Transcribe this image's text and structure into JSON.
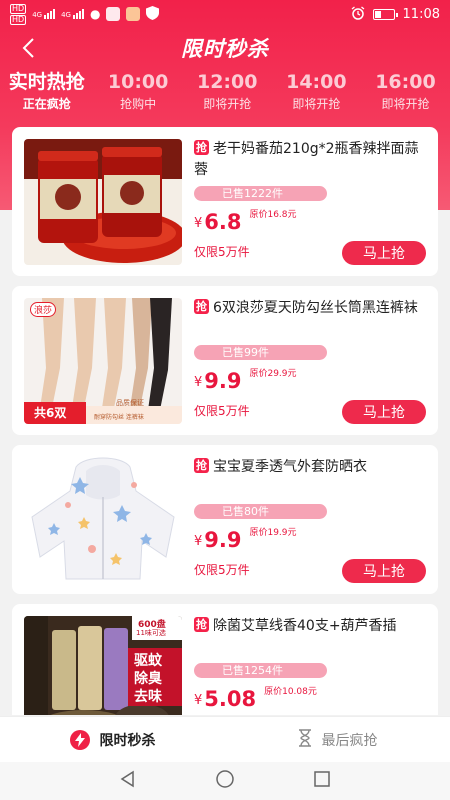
{
  "status_bar": {
    "time": "11:08",
    "left_chips": [
      "HD",
      "HD"
    ],
    "network_labels": [
      "4G",
      "4G"
    ]
  },
  "header": {
    "title": "限时秒杀",
    "back_icon": "back-arrow-icon"
  },
  "timeline": [
    {
      "time": "实时热抢",
      "status": "正在疯抢",
      "active": true
    },
    {
      "time": "10:00",
      "status": "抢购中"
    },
    {
      "time": "12:00",
      "status": "即将开抢"
    },
    {
      "time": "14:00",
      "status": "即将开抢"
    },
    {
      "time": "16:00",
      "status": "即将开抢"
    }
  ],
  "tag_label": "抢",
  "buy_label": "马上抢",
  "products": [
    {
      "name": "老干妈番茄210g*2瓶香辣拌面蒜蓉",
      "sold": "已售1222件",
      "yen": "¥",
      "price": "6.8",
      "original": "原价16.8元",
      "limit": "仅限5万件"
    },
    {
      "name": "6双浪莎夏天防勾丝长筒黑连裤袜",
      "sold": "已售99件",
      "yen": "¥",
      "price": "9.9",
      "original": "原价29.9元",
      "limit": "仅限5万件",
      "image_text": {
        "brand": "浪莎",
        "count": "共6双",
        "badge_top": "品质保证",
        "badge_bottom": "耐穿防勾丝 连裤袜"
      }
    },
    {
      "name": "宝宝夏季透气外套防晒衣",
      "sold": "已售80件",
      "yen": "¥",
      "price": "9.9",
      "original": "原价19.9元",
      "limit": "仅限5万件"
    },
    {
      "name": "除菌艾草线香40支+葫芦香插",
      "sold": "已售1254件",
      "yen": "¥",
      "price": "5.08",
      "original": "原价10.08元",
      "limit": "",
      "image_text": {
        "corner_top": "600盘",
        "corner_bottom": "11味可选",
        "slogan": [
          "驱蚊",
          "除臭",
          "去味"
        ]
      }
    }
  ],
  "tabs": [
    {
      "label": "限时秒杀",
      "icon": "lightning-icon",
      "active": true
    },
    {
      "label": "最后疯抢",
      "icon": "hourglass-icon",
      "active": false
    }
  ],
  "colors": {
    "primary": "#f2214a",
    "price": "#e8163e",
    "sold_bar": "#f6a3b5"
  }
}
